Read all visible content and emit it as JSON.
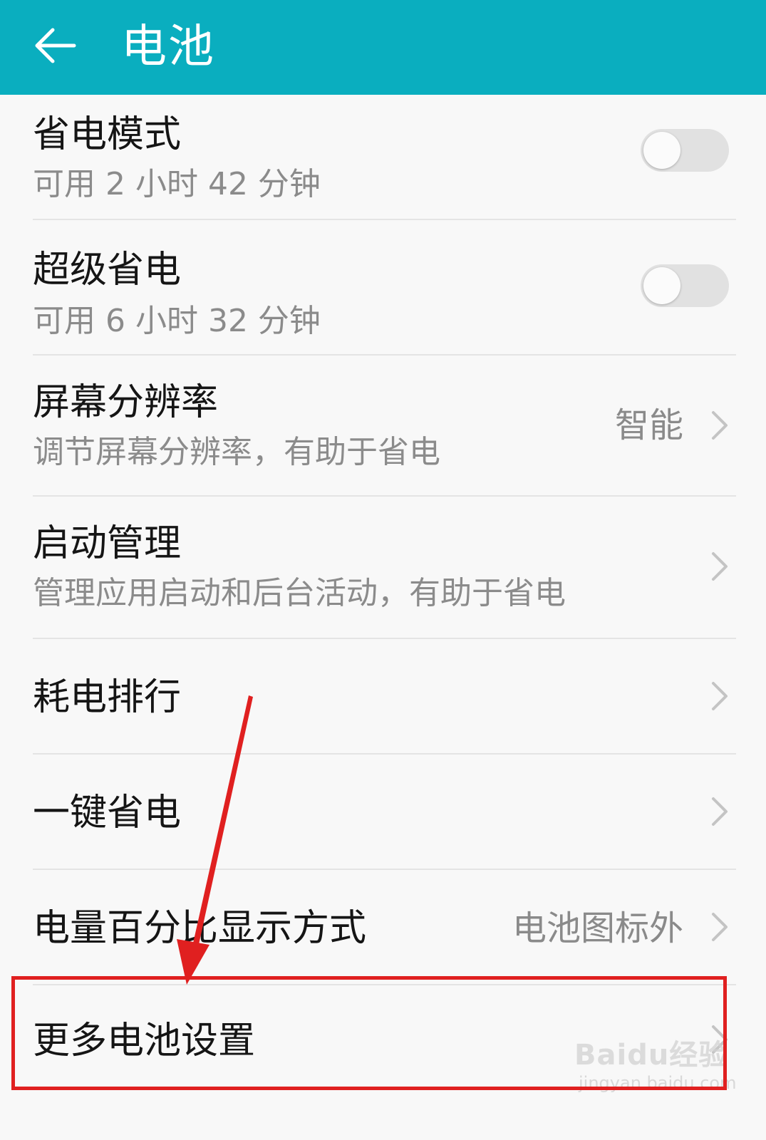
{
  "header": {
    "title": "电池",
    "back_icon": "back-arrow-icon",
    "background": "#0aaebf"
  },
  "rows": [
    {
      "title": "省电模式",
      "subtitle": "可用 2 小时 42 分钟",
      "control": "toggle",
      "toggle_on": false
    },
    {
      "title": "超级省电",
      "subtitle": "可用 6 小时 32 分钟",
      "control": "toggle",
      "toggle_on": false
    },
    {
      "title": "屏幕分辨率",
      "subtitle": "调节屏幕分辨率，有助于省电",
      "value": "智能",
      "control": "chevron"
    },
    {
      "title": "启动管理",
      "subtitle": "管理应用启动和后台活动，有助于省电",
      "control": "chevron"
    },
    {
      "title": "耗电排行",
      "control": "chevron"
    },
    {
      "title": "一键省电",
      "control": "chevron"
    },
    {
      "title": "电量百分比显示方式",
      "value": "电池图标外",
      "control": "chevron"
    },
    {
      "title": "更多电池设置",
      "control": "chevron",
      "highlighted": true
    }
  ],
  "annotation": {
    "color": "#e02020",
    "arrow_target": "更多电池设置"
  },
  "watermark": {
    "logo": "Baidu经验",
    "url": "jingyan.baidu.com"
  }
}
